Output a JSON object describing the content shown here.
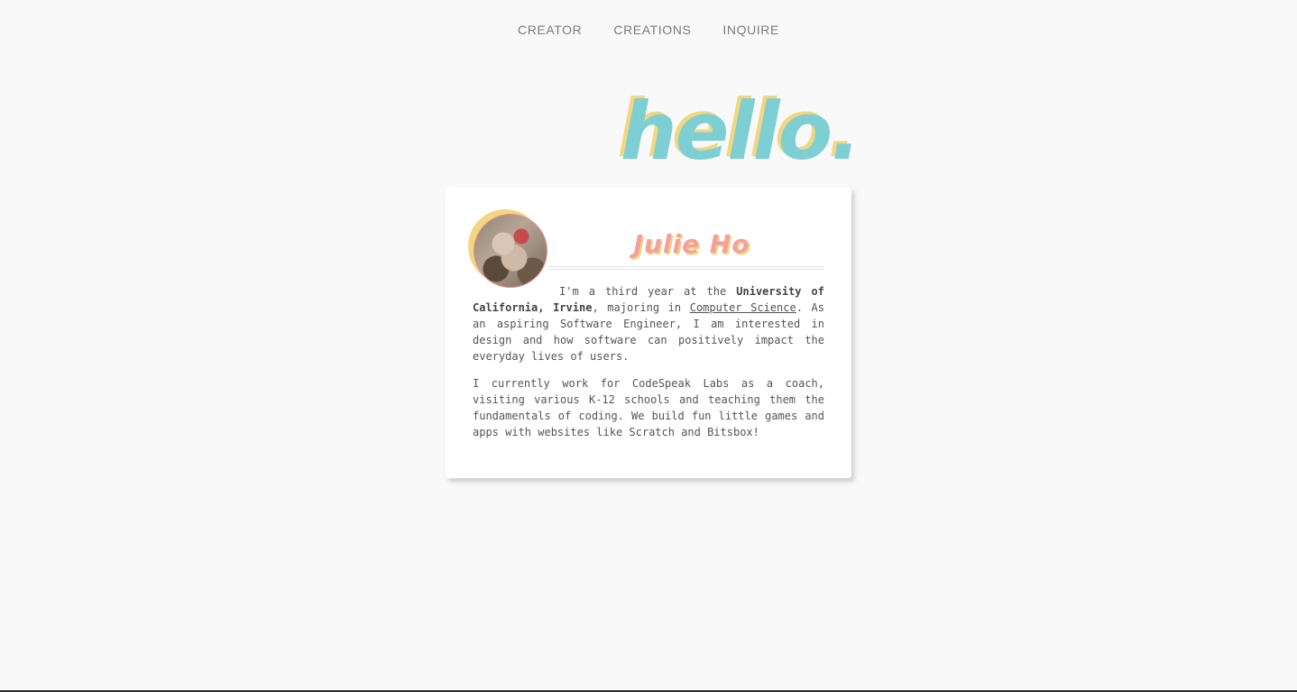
{
  "nav": {
    "items": [
      {
        "label": "CREATOR"
      },
      {
        "label": "CREATIONS"
      },
      {
        "label": "INQUIRE"
      }
    ]
  },
  "hero": {
    "title": "hello."
  },
  "card": {
    "name": "Julie Ho",
    "bio": {
      "p1": {
        "t1": "I'm a third year at the ",
        "school": "University of California, Irvine",
        "t2": ", majoring in ",
        "major": "Computer Science",
        "t3": ". As an aspiring Software Engineer, I am interested in design and how software can positively impact the everyday lives of users."
      },
      "p2": "I currently work for CodeSpeak Labs as a coach, visiting various K-12 schools and teaching them the fundamentals of coding. We build fun little games and apps with websites like Scratch and Bitsbox!"
    }
  },
  "colors": {
    "background": "#f9f9f9",
    "accent_teal": "#7ecfd4",
    "accent_yellow": "#f2d680",
    "accent_pink": "#f4a0a0",
    "nav_text": "#7a7a7a",
    "body_text": "#555555"
  }
}
